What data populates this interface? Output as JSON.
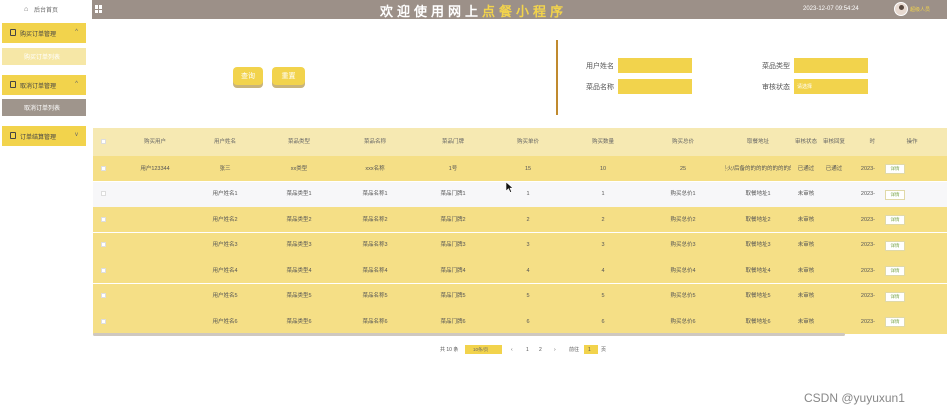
{
  "topbar": {
    "home_label": "后台首页",
    "title_part1": "欢迎使用网上",
    "title_part2": "点餐小程序",
    "datetime": "2023-12-07 09:54:24",
    "user_label": "超级人员"
  },
  "sidebar": {
    "group1": "购买订单管理",
    "sub1": "购买订单列表",
    "group2": "取消订单管理",
    "sub2": "取消订单列表",
    "group3": "订单结算管理"
  },
  "toolbar": {
    "query_label": "查询",
    "reset_label": "重置"
  },
  "filters": {
    "username_label": "用户姓名",
    "dish_type_label": "菜品类型",
    "dish_name_label": "菜品名称",
    "audit_status_label": "审核状态",
    "audit_status_value": "请选择"
  },
  "table": {
    "headers": [
      "购买用户",
      "用户姓名",
      "菜品类型",
      "菜品名称",
      "菜品门牌",
      "购买单价",
      "购买数量",
      "购买总价",
      "取餐地址",
      "审核状态",
      "审核回复",
      "时",
      "操作"
    ],
    "detail_label": "详情",
    "rows": [
      [
        "用户123344",
        "张三",
        "xx类型",
        "xxx名称",
        "1号",
        "15",
        "10",
        "25",
        "冬火/后备的的的的的的的的的",
        "已通过",
        "已通过",
        "2023-"
      ],
      [
        "",
        "用户姓名1",
        "菜品类型1",
        "菜品名称1",
        "菜品门牌1",
        "1",
        "1",
        "购买总价1",
        "取餐地址1",
        "未审核",
        "",
        "2023-"
      ],
      [
        "",
        "用户姓名2",
        "菜品类型2",
        "菜品名称2",
        "菜品门牌2",
        "2",
        "2",
        "购买总价2",
        "取餐地址2",
        "未审核",
        "",
        "2023-"
      ],
      [
        "",
        "用户姓名3",
        "菜品类型3",
        "菜品名称3",
        "菜品门牌3",
        "3",
        "3",
        "购买总价3",
        "取餐地址3",
        "未审核",
        "",
        "2023-"
      ],
      [
        "",
        "用户姓名4",
        "菜品类型4",
        "菜品名称4",
        "菜品门牌4",
        "4",
        "4",
        "购买总价4",
        "取餐地址4",
        "未审核",
        "",
        "2023-"
      ],
      [
        "",
        "用户姓名5",
        "菜品类型5",
        "菜品名称5",
        "菜品门牌5",
        "5",
        "5",
        "购买总价5",
        "取餐地址5",
        "未审核",
        "",
        "2023-"
      ],
      [
        "",
        "用户姓名6",
        "菜品类型6",
        "菜品名称6",
        "菜品门牌6",
        "6",
        "6",
        "购买总价6",
        "取餐地址6",
        "未审核",
        "",
        "2023-"
      ]
    ]
  },
  "pagination": {
    "total_text": "共 10 条",
    "page_size_text": "10条/页",
    "prev": "‹",
    "page1": "1",
    "page2": "2",
    "next": "›",
    "goto_label": "前往",
    "goto_value": "1",
    "page_suffix": "页"
  },
  "watermark": "CSDN @yuyuxun1",
  "colors": {
    "accent": "#f2d34c",
    "topbar": "#9c9088",
    "row_yellow": "#f5df86"
  }
}
